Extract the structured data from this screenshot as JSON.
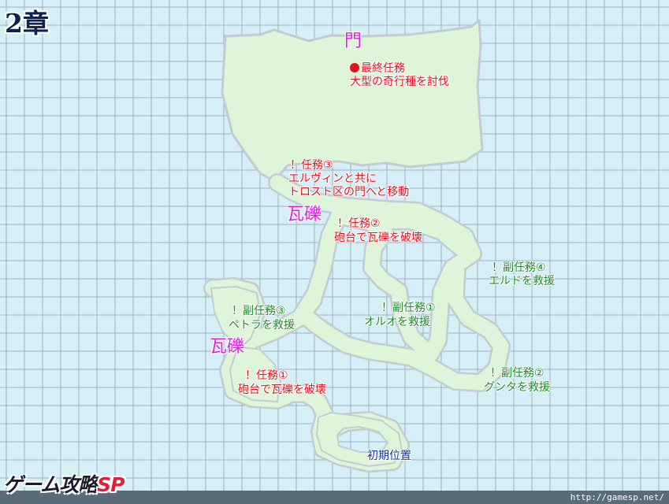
{
  "chapter_title": "2章",
  "brand": {
    "main": "ゲーム攻略",
    "suffix": "SP"
  },
  "site_url": "http://gamesp.net/",
  "colors": {
    "background": "#d6eef6",
    "grid_line": "#9fb2bf",
    "walkable_fill": "#dff5d9",
    "walkable_outline": "#c3ccd0",
    "main_mission": "#e8101e",
    "sub_mission": "#1f8a2a",
    "start_point": "#1a2fa6",
    "landmark": "#e21ce0"
  },
  "landmarks": {
    "gate": "門",
    "rubble_upper": "瓦礫",
    "rubble_lower": "瓦礫"
  },
  "missions": {
    "final": {
      "title": "最終任務",
      "description": "大型の奇行種を討伐",
      "marker_icon": "red-dot-icon"
    },
    "m3": {
      "title": "！任務③",
      "description_1": "エルヴィンと共に",
      "description_2": "トロスト区の門へと移動"
    },
    "m2": {
      "title": "！任務②",
      "description": "砲台で瓦礫を破壊"
    },
    "m1": {
      "title": "！任務①",
      "description": "砲台で瓦礫を破壊"
    }
  },
  "sub_missions": {
    "s1": {
      "title": "！副任務①",
      "description": "オルオを救援"
    },
    "s2": {
      "title": "！副任務②",
      "description": "グンタを救援"
    },
    "s3": {
      "title": "！副任務③",
      "description": "ペトラを救援"
    },
    "s4": {
      "title": "！副任務④",
      "description": "エルドを救援"
    }
  },
  "start_point": "初期位置"
}
